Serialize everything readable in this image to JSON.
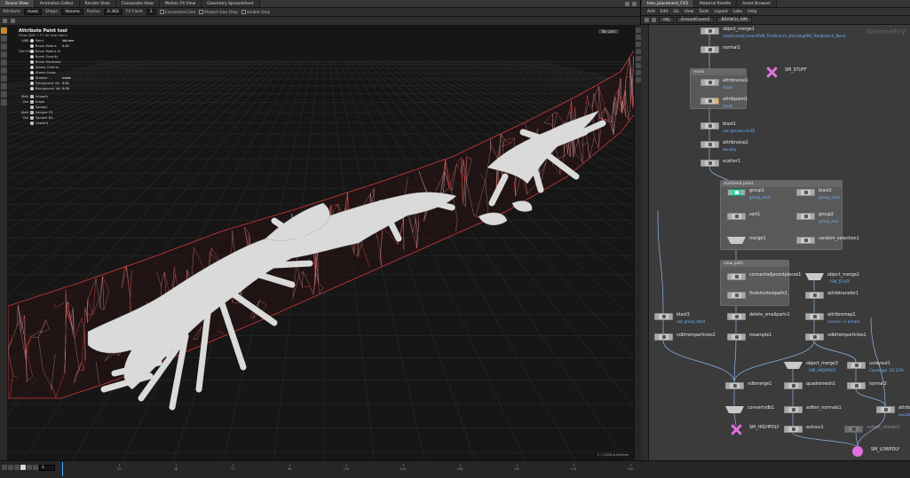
{
  "left_tabs": [
    "Scene View",
    "Animation Editor",
    "Render View",
    "Composite View",
    "Motion FX View",
    "Geometry Spreadsheet"
  ],
  "viewer_toolbar": {
    "attribute_label": "Attribute",
    "attribute_value": "mask",
    "shape_label": "Shape",
    "shape_value": "Volume",
    "radius_label": "Radius",
    "radius_value": "0.363",
    "fx_label": "FX Flash",
    "fx_value": "1",
    "connected_geo": "Connected Geo",
    "project_geo": "Project Geo Only",
    "visible_only": "Visible Only"
  },
  "paint_panel": {
    "title": "Attribute Paint tool",
    "hint": "Press Shift + F1 for help menu",
    "rows": [
      {
        "key": "LMB",
        "label": "Paint",
        "value": "Volume"
      },
      {
        "key": "",
        "label": "Brush Radius",
        "value": "0.41"
      },
      {
        "key": "Ctrl+Shift",
        "label": "Brush Radius Scale",
        "value": ""
      },
      {
        "key": "",
        "label": "Brush Opacity",
        "value": ""
      },
      {
        "key": "",
        "label": "Brush Hardness",
        "value": ""
      },
      {
        "key": "",
        "label": "Stamp Outline",
        "value": ""
      },
      {
        "key": "",
        "label": "Stamp Holes",
        "value": ""
      },
      {
        "key": "",
        "label": "Strokes",
        "value": "mask"
      },
      {
        "key": "",
        "label": "Foreground Val",
        "value": "0.81"
      },
      {
        "key": "",
        "label": "Background Val",
        "value": "0.00"
      }
    ],
    "shortcuts": [
      {
        "key": "Shift",
        "label": "Smooth"
      },
      {
        "key": "Ctrl",
        "label": "Erase"
      },
      {
        "key": "",
        "label": "Sample"
      },
      {
        "key": "Shift",
        "label": "Sample FG"
      },
      {
        "key": "Ctrl",
        "label": "Sample BG"
      },
      {
        "key": "",
        "label": "Unpaint"
      }
    ]
  },
  "viewport": {
    "camera": "No cam",
    "corner_note": "0 / 2,458 primitives"
  },
  "right_tabs": [
    "tree_placement_FX3",
    "Material Palette",
    "Asset Browser"
  ],
  "net_menu": [
    "Add",
    "Edit",
    "Go",
    "View",
    "Tools",
    "Layout",
    "Labs",
    "Help"
  ],
  "net_path": [
    "obj",
    "GroundCover2",
    "BRANCH_SIM"
  ],
  "net_title": "Geometry",
  "netboxes": [
    {
      "title": "mask"
    },
    {
      "title": "start/end point"
    },
    {
      "title": "view path"
    }
  ],
  "nodes": [
    {
      "name": "object_merge1",
      "sub": "/obj/UnrealContent/SM_TreeBranch_Bending/SM_TreeBranch_Bend"
    },
    {
      "name": "normal1",
      "sub": ""
    },
    {
      "name": "SM_STUFF",
      "sub": ""
    },
    {
      "name": "attribnoise1",
      "sub": "mask"
    },
    {
      "name": "attribpaint1",
      "sub": "mask"
    },
    {
      "name": "blast1",
      "sub": "not @mask>0.65"
    },
    {
      "name": "attribnoise2",
      "sub": "density"
    },
    {
      "name": "scatter1",
      "sub": ""
    },
    {
      "name": "group1",
      "sub": "group_start"
    },
    {
      "name": "blast2",
      "sub": "group_start"
    },
    {
      "name": "sort1",
      "sub": ""
    },
    {
      "name": "group2",
      "sub": "group_end"
    },
    {
      "name": "merge1",
      "sub": ""
    },
    {
      "name": "random_selection1",
      "sub": ""
    },
    {
      "name": "connectadjacentpieces1",
      "sub": ""
    },
    {
      "name": "object_merge2",
      "sub": "../SM_STUFF"
    },
    {
      "name": "findshortestpath1",
      "sub": ""
    },
    {
      "name": "attribtransfer1",
      "sub": ""
    },
    {
      "name": "blast3",
      "sub": "not group_start"
    },
    {
      "name": "delete_smallparts1",
      "sub": ""
    },
    {
      "name": "attribremap1",
      "sub": "convex -> pscale"
    },
    {
      "name": "vdbfromparticles2",
      "sub": ""
    },
    {
      "name": "resample1",
      "sub": ""
    },
    {
      "name": "vdbfromparticles1",
      "sub": ""
    },
    {
      "name": "object_merge3",
      "sub": "../SM_HIGHPOLY"
    },
    {
      "name": "uvlayout1",
      "sub": "Coverage: 26.12%"
    },
    {
      "name": "vdbmerge1",
      "sub": ""
    },
    {
      "name": "quadremesh1",
      "sub": ""
    },
    {
      "name": "normal2",
      "sub": ""
    },
    {
      "name": "convertvdb1",
      "sub": ""
    },
    {
      "name": "soften_normals1",
      "sub": ""
    },
    {
      "name": "attrib",
      "sub": "pscale"
    },
    {
      "name": "SM_HIGHPOLY",
      "sub": ""
    },
    {
      "name": "autouv1",
      "sub": ""
    },
    {
      "name": "output_shader1",
      "sub": ""
    },
    {
      "name": "SM_LOWPOLY",
      "sub": ""
    }
  ],
  "timeline": {
    "frame": "1",
    "ticks": [
      "1",
      "24",
      "48",
      "72",
      "96",
      "120",
      "144",
      "168",
      "192",
      "216",
      "240"
    ]
  },
  "colors": {
    "wire": "#d23a3a",
    "mesh": "#dadada",
    "display_flag": "#3fd1a8",
    "object_node": "#e070e0",
    "link_blue": "#6fb3ff"
  }
}
